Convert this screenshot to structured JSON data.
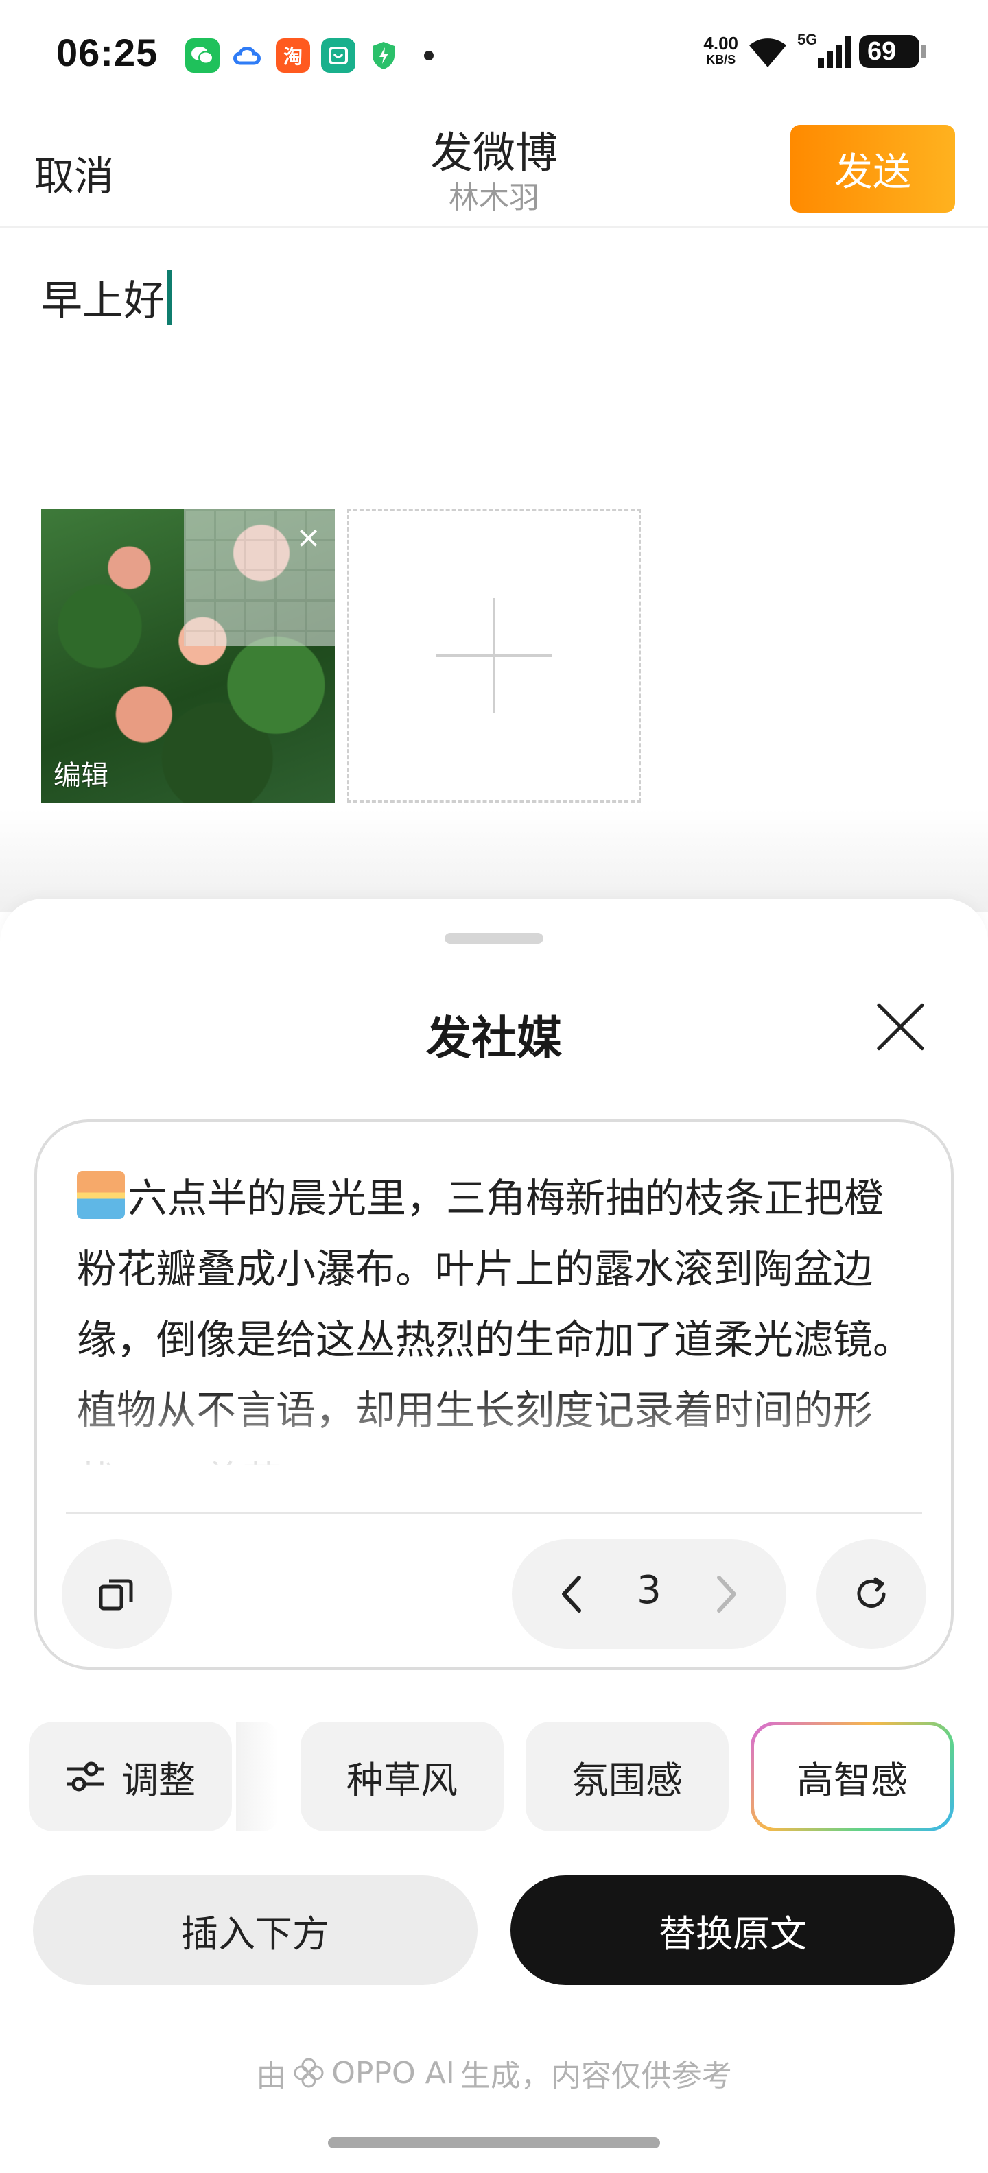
{
  "status_bar": {
    "time": "06:25",
    "net_speed_value": "4.00",
    "net_speed_unit": "KB/S",
    "network": "5G",
    "battery": "69",
    "apps": [
      "wechat-icon",
      "cloud-icon",
      "taobao-icon",
      "mi-home-icon",
      "shield-icon"
    ],
    "taobao_label": "淘"
  },
  "header": {
    "cancel_label": "取消",
    "title": "发微博",
    "subtitle": "林木羽",
    "send_label": "发送"
  },
  "post": {
    "text": "早上好"
  },
  "image": {
    "edit_label": "编辑",
    "close_symbol": "×"
  },
  "sheet": {
    "title": "发社媒",
    "generated_text": "六点半的晨光里，三角梅新抽的枝条正把橙粉花瓣叠成小瀑布。叶片上的露水滚到陶盆边缘，倒像是给这丛热烈的生命加了道柔光滤镜。植物从不言语，却用生长刻度记录着时间的形状。 #养花#",
    "page_number": "3",
    "chips": {
      "adjust": "调整",
      "zhongcao": "种草风",
      "fenwei": "氛围感",
      "gaozhi": "高智感"
    },
    "insert_label": "插入下方",
    "replace_label": "替换原文",
    "footnote_prefix": "由",
    "footnote_brand": "OPPO AI",
    "footnote_suffix": "生成，内容仅供参考"
  },
  "colors": {
    "accent_orange": "#ff8a00",
    "caret_teal": "#0f7d6e",
    "dark_button": "#141414"
  }
}
